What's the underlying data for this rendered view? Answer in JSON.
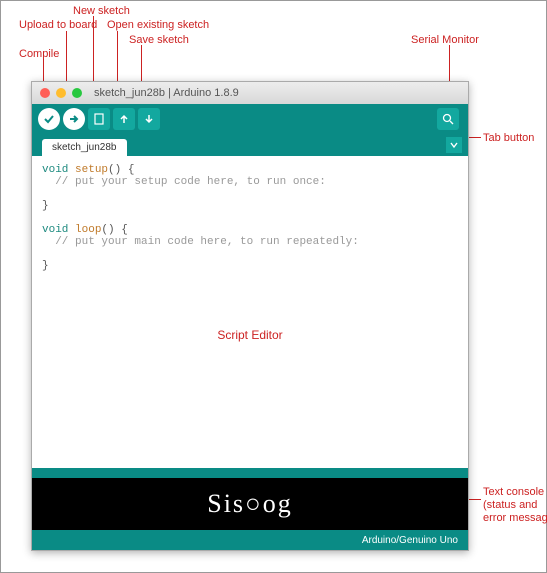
{
  "annotations": {
    "compile": "Compile",
    "upload": "Upload to board",
    "new": "New sketch",
    "open": "Open existing sketch",
    "save": "Save sketch",
    "serial": "Serial Monitor",
    "tab": "Tab button",
    "script": "Script Editor",
    "console": "Text console\n(status and\nerror messages)"
  },
  "window": {
    "title": "sketch_jun28b | Arduino 1.8.9"
  },
  "tab": {
    "name": "sketch_jun28b"
  },
  "code": {
    "line1a": "void",
    "line1b": "setup",
    "line1c": "() {",
    "line2": "  // put your setup code here, to run once:",
    "line3": "",
    "line4": "}",
    "line5": "",
    "line6a": "void",
    "line6b": "loop",
    "line6c": "() {",
    "line7": "  // put your main code here, to run repeatedly:",
    "line8": "",
    "line9": "}"
  },
  "console_text": "Sis○og",
  "status": {
    "board": "Arduino/Genuino Uno"
  }
}
